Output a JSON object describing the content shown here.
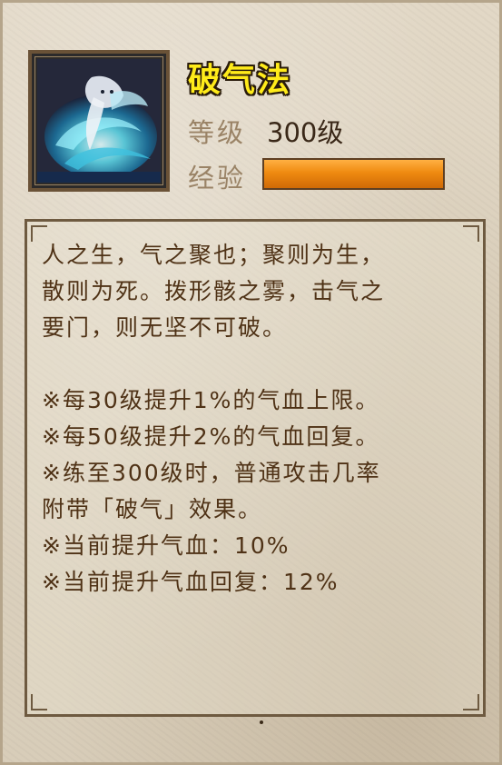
{
  "skill": {
    "name": "破气法",
    "portrait_icon": "sage-casting-blue-vortex-icon"
  },
  "stats": {
    "level_label": "等级",
    "level_value": "300级",
    "exp_label": "经验",
    "exp_progress": 1.0
  },
  "description": {
    "lines": [
      "人之生，气之聚也；聚则为生，",
      "散则为死。拨形骸之雾，击气之",
      "要门，则无坚不可破。",
      "",
      "※每30级提升1%的气血上限。",
      "※每50级提升2%的气血回复。",
      "※练至300级时，普通攻击几率",
      "附带「破气」效果。",
      "※当前提升气血：10%",
      "※当前提升气血回复：12%"
    ]
  },
  "colors": {
    "title": "#ffeb1a",
    "exp_bar": "#ef8a10",
    "text": "#4f3216",
    "label": "#9a8366"
  }
}
